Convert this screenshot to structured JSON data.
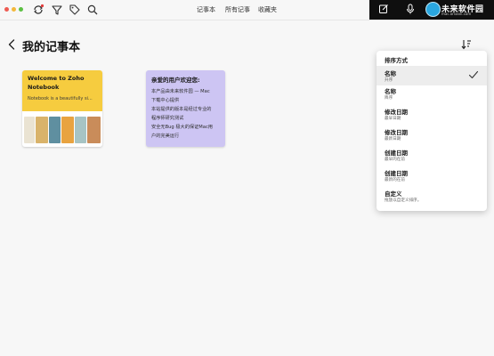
{
  "nav": {
    "notebooks": "记事本",
    "all_notes": "所有记事",
    "favorites": "收藏夹"
  },
  "header": {
    "title": "我的记事本"
  },
  "notebooks": [
    {
      "title": "Welcome to Zoho Notebook",
      "preview": "Notebook is a beautifully si...",
      "cover_color": "#f6cc3f"
    },
    {
      "title": "亲爱的用户欢迎您:",
      "lines": [
        "本产品由未来软件园 — Mac",
        "下载中心提供",
        "本站提供的版本是经过专业的",
        "程序师研究测试",
        "安全无Bug 极大的保证Mac用",
        "户的完美运行"
      ],
      "cover_color": "#cdc5f3"
    }
  ],
  "sort_menu": {
    "header": "排序方式",
    "items": [
      {
        "label": "名称",
        "desc": "升序",
        "selected": true
      },
      {
        "label": "名称",
        "desc": "降序",
        "selected": false
      },
      {
        "label": "修改日期",
        "desc": "最早日期",
        "selected": false
      },
      {
        "label": "修改日期",
        "desc": "最新日期",
        "selected": false
      },
      {
        "label": "创建日期",
        "desc": "最早的在前",
        "selected": false
      },
      {
        "label": "创建日期",
        "desc": "最新的在前",
        "selected": false
      },
      {
        "label": "自定义",
        "desc": "拖放以自定义排序。",
        "selected": false
      }
    ]
  },
  "watermark": {
    "brand": "未来软件园",
    "url": "mac.orsoon.com"
  },
  "colors": {
    "accent_yellow": "#f6cc3f",
    "accent_lavender": "#cdc5f3",
    "toolbar_dark": "#0f0f0f",
    "sync_dot": "#e23b3b"
  },
  "icons": [
    "sync-icon",
    "filter-icon",
    "tag-icon",
    "search-icon",
    "back-arrow-icon",
    "sort-icon",
    "new-note-icon",
    "microphone-icon",
    "checkmark-icon"
  ]
}
